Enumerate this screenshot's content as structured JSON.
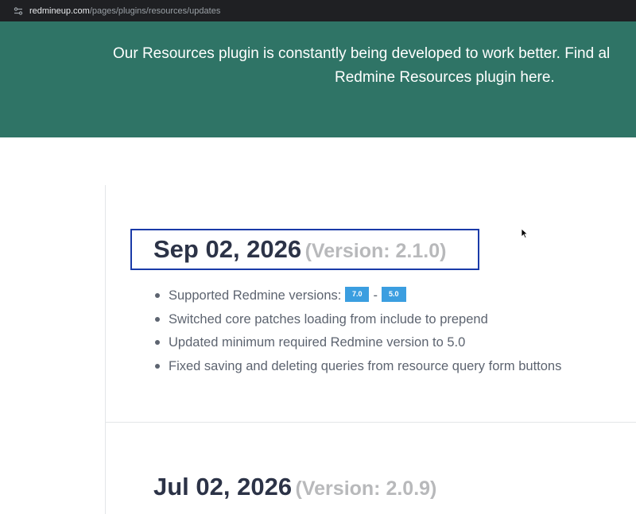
{
  "browser": {
    "url_host": "redmineup.com",
    "url_path": "/pages/plugins/resources/updates",
    "site_info_icon": "tune-icon"
  },
  "hero": {
    "line1": "Our Resources plugin is constantly being developed to work better. Find al",
    "line2": "Redmine Resources plugin here."
  },
  "updates": [
    {
      "date": "Sep 02, 2026",
      "version": "(Version: 2.1.0)",
      "changes": {
        "supported_label": "Supported Redmine versions:",
        "version_from": "7.0",
        "separator": "-",
        "version_to": "5.0",
        "item2": "Switched core patches loading from include to prepend",
        "item3": "Updated minimum required Redmine version to 5.0",
        "item4": "Fixed saving and deleting queries from resource query form buttons"
      }
    },
    {
      "date": "Jul 02, 2026",
      "version": "(Version: 2.0.9)"
    }
  ],
  "colors": {
    "hero_bg": "#2f7466",
    "date_text": "#2c3347",
    "version_text": "#b8b9bb",
    "badge_bg": "#3b9ee0",
    "focus_border": "#1a3aa8"
  }
}
